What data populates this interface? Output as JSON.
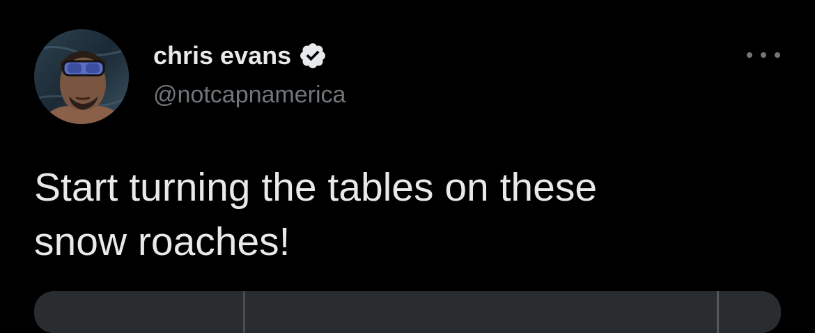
{
  "tweet": {
    "author": {
      "display_name": "chris evans",
      "handle": "@notcapnamerica",
      "verified": true,
      "avatar_icon": "avatar-photo"
    },
    "text": "Start turning the tables on these\nsnow roaches!",
    "menu_icon": "more-horizontal-icon"
  },
  "colors": {
    "background": "#000000",
    "primary_text": "#e7e9ea",
    "secondary_text": "#71767b",
    "verified_badge": "#e7e9ea"
  }
}
